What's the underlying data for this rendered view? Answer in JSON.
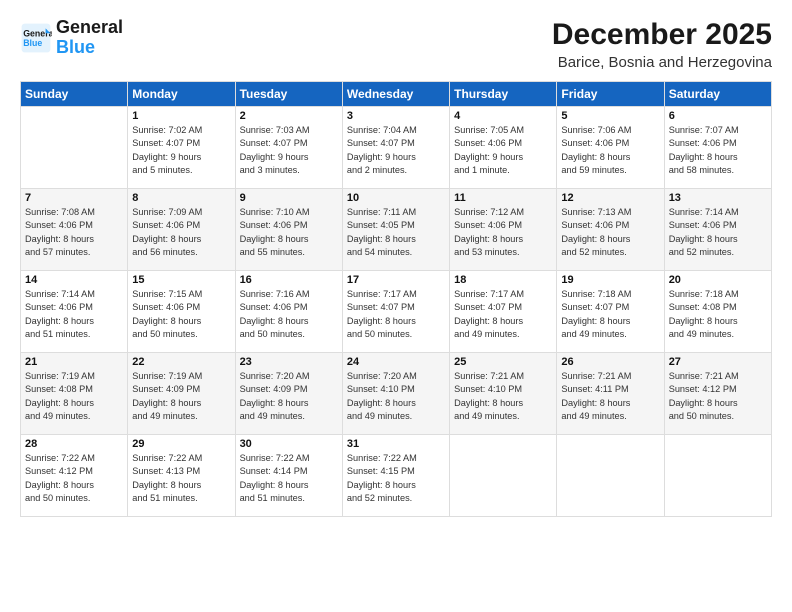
{
  "header": {
    "logo_line1": "General",
    "logo_line2": "Blue",
    "title": "December 2025",
    "subtitle": "Barice, Bosnia and Herzegovina"
  },
  "days_of_week": [
    "Sunday",
    "Monday",
    "Tuesday",
    "Wednesday",
    "Thursday",
    "Friday",
    "Saturday"
  ],
  "weeks": [
    [
      {
        "num": "",
        "info": ""
      },
      {
        "num": "1",
        "info": "Sunrise: 7:02 AM\nSunset: 4:07 PM\nDaylight: 9 hours\nand 5 minutes."
      },
      {
        "num": "2",
        "info": "Sunrise: 7:03 AM\nSunset: 4:07 PM\nDaylight: 9 hours\nand 3 minutes."
      },
      {
        "num": "3",
        "info": "Sunrise: 7:04 AM\nSunset: 4:07 PM\nDaylight: 9 hours\nand 2 minutes."
      },
      {
        "num": "4",
        "info": "Sunrise: 7:05 AM\nSunset: 4:06 PM\nDaylight: 9 hours\nand 1 minute."
      },
      {
        "num": "5",
        "info": "Sunrise: 7:06 AM\nSunset: 4:06 PM\nDaylight: 8 hours\nand 59 minutes."
      },
      {
        "num": "6",
        "info": "Sunrise: 7:07 AM\nSunset: 4:06 PM\nDaylight: 8 hours\nand 58 minutes."
      }
    ],
    [
      {
        "num": "7",
        "info": "Sunrise: 7:08 AM\nSunset: 4:06 PM\nDaylight: 8 hours\nand 57 minutes."
      },
      {
        "num": "8",
        "info": "Sunrise: 7:09 AM\nSunset: 4:06 PM\nDaylight: 8 hours\nand 56 minutes."
      },
      {
        "num": "9",
        "info": "Sunrise: 7:10 AM\nSunset: 4:06 PM\nDaylight: 8 hours\nand 55 minutes."
      },
      {
        "num": "10",
        "info": "Sunrise: 7:11 AM\nSunset: 4:05 PM\nDaylight: 8 hours\nand 54 minutes."
      },
      {
        "num": "11",
        "info": "Sunrise: 7:12 AM\nSunset: 4:06 PM\nDaylight: 8 hours\nand 53 minutes."
      },
      {
        "num": "12",
        "info": "Sunrise: 7:13 AM\nSunset: 4:06 PM\nDaylight: 8 hours\nand 52 minutes."
      },
      {
        "num": "13",
        "info": "Sunrise: 7:14 AM\nSunset: 4:06 PM\nDaylight: 8 hours\nand 52 minutes."
      }
    ],
    [
      {
        "num": "14",
        "info": "Sunrise: 7:14 AM\nSunset: 4:06 PM\nDaylight: 8 hours\nand 51 minutes."
      },
      {
        "num": "15",
        "info": "Sunrise: 7:15 AM\nSunset: 4:06 PM\nDaylight: 8 hours\nand 50 minutes."
      },
      {
        "num": "16",
        "info": "Sunrise: 7:16 AM\nSunset: 4:06 PM\nDaylight: 8 hours\nand 50 minutes."
      },
      {
        "num": "17",
        "info": "Sunrise: 7:17 AM\nSunset: 4:07 PM\nDaylight: 8 hours\nand 50 minutes."
      },
      {
        "num": "18",
        "info": "Sunrise: 7:17 AM\nSunset: 4:07 PM\nDaylight: 8 hours\nand 49 minutes."
      },
      {
        "num": "19",
        "info": "Sunrise: 7:18 AM\nSunset: 4:07 PM\nDaylight: 8 hours\nand 49 minutes."
      },
      {
        "num": "20",
        "info": "Sunrise: 7:18 AM\nSunset: 4:08 PM\nDaylight: 8 hours\nand 49 minutes."
      }
    ],
    [
      {
        "num": "21",
        "info": "Sunrise: 7:19 AM\nSunset: 4:08 PM\nDaylight: 8 hours\nand 49 minutes."
      },
      {
        "num": "22",
        "info": "Sunrise: 7:19 AM\nSunset: 4:09 PM\nDaylight: 8 hours\nand 49 minutes."
      },
      {
        "num": "23",
        "info": "Sunrise: 7:20 AM\nSunset: 4:09 PM\nDaylight: 8 hours\nand 49 minutes."
      },
      {
        "num": "24",
        "info": "Sunrise: 7:20 AM\nSunset: 4:10 PM\nDaylight: 8 hours\nand 49 minutes."
      },
      {
        "num": "25",
        "info": "Sunrise: 7:21 AM\nSunset: 4:10 PM\nDaylight: 8 hours\nand 49 minutes."
      },
      {
        "num": "26",
        "info": "Sunrise: 7:21 AM\nSunset: 4:11 PM\nDaylight: 8 hours\nand 49 minutes."
      },
      {
        "num": "27",
        "info": "Sunrise: 7:21 AM\nSunset: 4:12 PM\nDaylight: 8 hours\nand 50 minutes."
      }
    ],
    [
      {
        "num": "28",
        "info": "Sunrise: 7:22 AM\nSunset: 4:12 PM\nDaylight: 8 hours\nand 50 minutes."
      },
      {
        "num": "29",
        "info": "Sunrise: 7:22 AM\nSunset: 4:13 PM\nDaylight: 8 hours\nand 51 minutes."
      },
      {
        "num": "30",
        "info": "Sunrise: 7:22 AM\nSunset: 4:14 PM\nDaylight: 8 hours\nand 51 minutes."
      },
      {
        "num": "31",
        "info": "Sunrise: 7:22 AM\nSunset: 4:15 PM\nDaylight: 8 hours\nand 52 minutes."
      },
      {
        "num": "",
        "info": ""
      },
      {
        "num": "",
        "info": ""
      },
      {
        "num": "",
        "info": ""
      }
    ]
  ]
}
